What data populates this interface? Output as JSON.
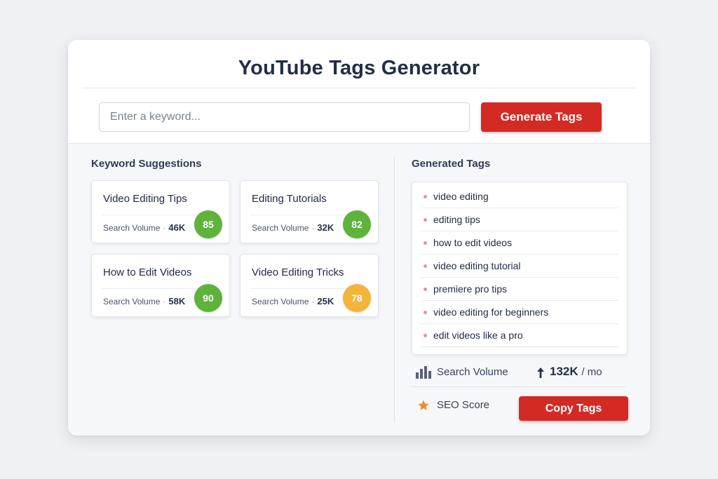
{
  "app": {
    "title": "YouTube Tags Generator"
  },
  "search": {
    "placeholder": "Enter a keyword...",
    "value": "",
    "button_label": "Generate Tags"
  },
  "suggestions": {
    "title": "Keyword Suggestions",
    "volume_label": "Search Volume",
    "separator": "·",
    "items": [
      {
        "name": "Video Editing Tips",
        "volume": "46K",
        "score": "85",
        "score_color": "#5db33b"
      },
      {
        "name": "Editing Tutorials",
        "volume": "32K",
        "score": "82",
        "score_color": "#5db33b"
      },
      {
        "name": "How to Edit Videos",
        "volume": "58K",
        "score": "90",
        "score_color": "#5db33b"
      },
      {
        "name": "Video Editing Tricks",
        "volume": "25K",
        "score": "78",
        "score_color": "#f2b53a"
      }
    ]
  },
  "tags": {
    "title": "Generated Tags",
    "items": [
      "video editing",
      "editing tips",
      "how to edit videos",
      "video editing tutorial",
      "premiere pro tips",
      "video editing for beginners",
      "edit videos like a pro"
    ]
  },
  "stats": {
    "volume_icon": "bar-chart-icon",
    "volume_label": "Search Volume",
    "trend_icon": "arrow-up-icon",
    "volume_value": "132K",
    "volume_unit": "/ mo",
    "seo_icon": "star-icon",
    "seo_label": "SEO Score",
    "seo_icon_color": "#e8902e"
  },
  "actions": {
    "copy_label": "Copy Tags"
  },
  "colors": {
    "accent": "#d42a24",
    "score_high": "#5db33b",
    "score_mid": "#f2b53a",
    "tag_bullet": "#e7929c"
  }
}
